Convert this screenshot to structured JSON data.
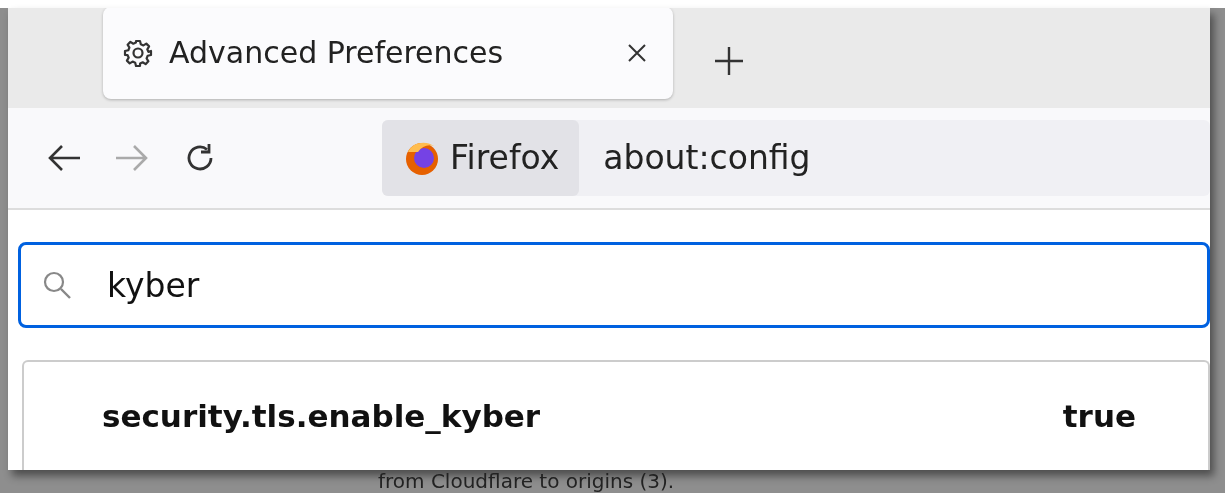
{
  "tabs": [
    {
      "label": "Advanced Preferences",
      "selected": true
    }
  ],
  "nav": {
    "back_disabled": false,
    "forward_disabled": true
  },
  "url_bar": {
    "identity": "Firefox",
    "url": "about:config"
  },
  "search": {
    "value": "kyber"
  },
  "prefs": [
    {
      "name": "security.tls.enable_kyber",
      "value": "true"
    }
  ],
  "background_text": "from Cloudflare to origins (3)."
}
